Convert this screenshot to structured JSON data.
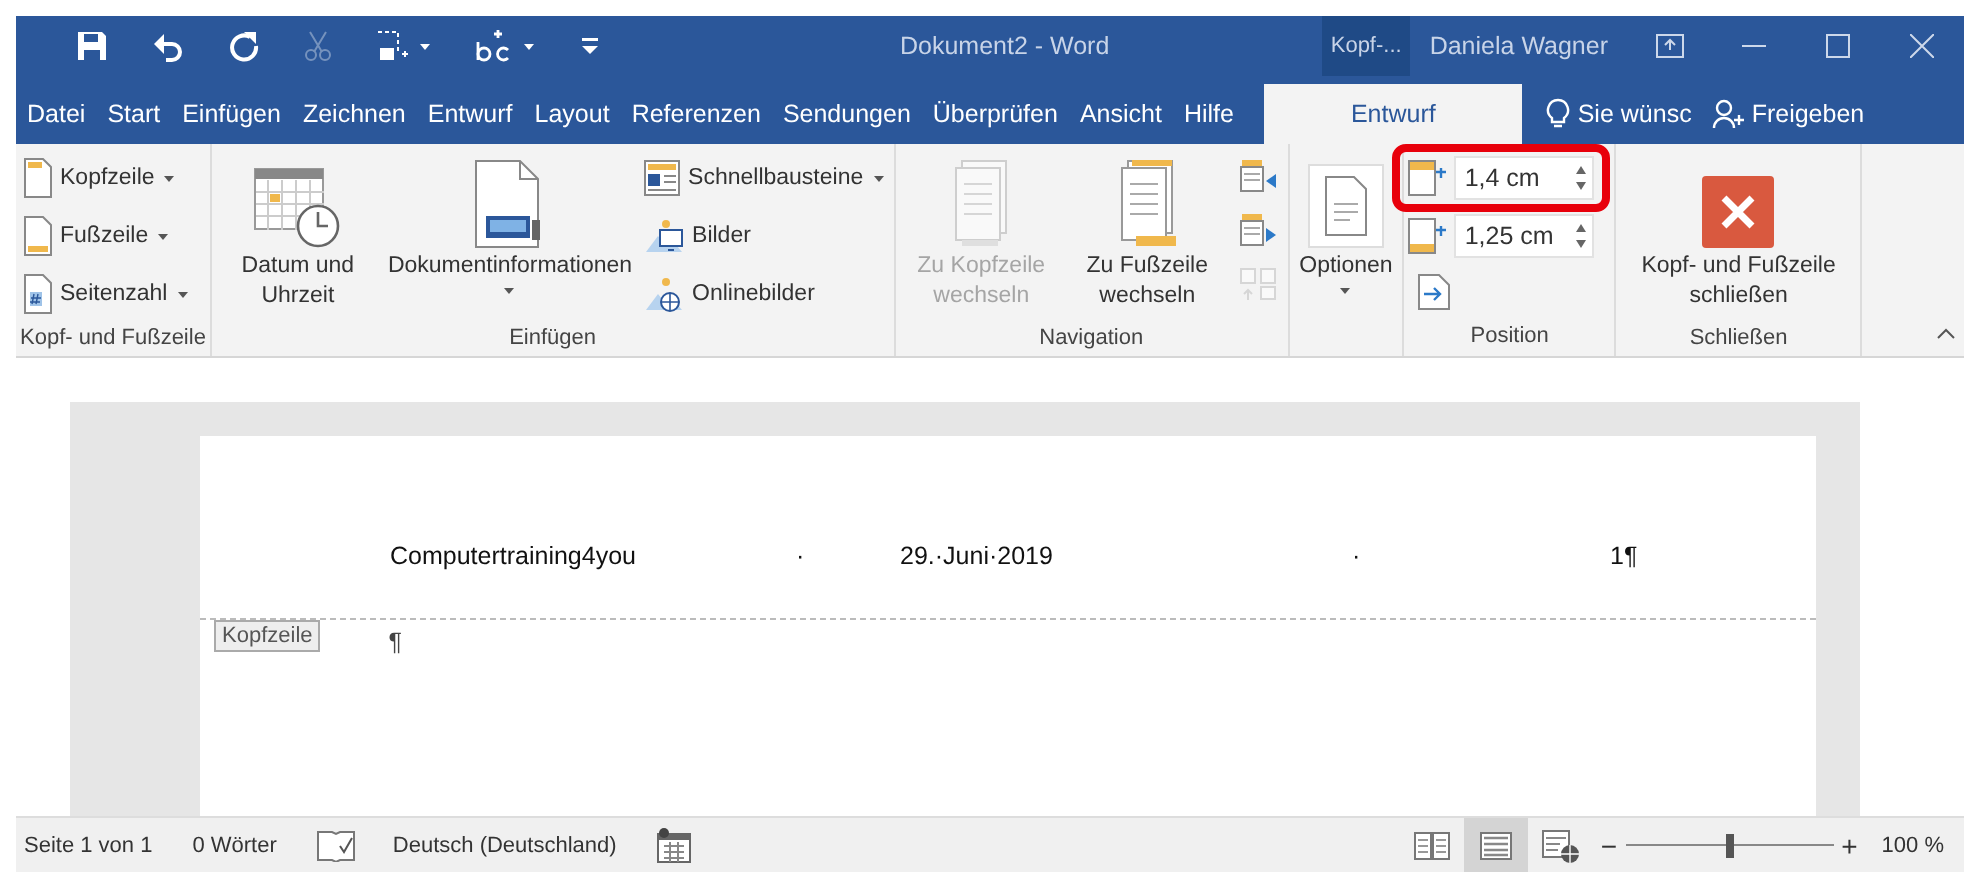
{
  "title_bar": {
    "quick_access": [
      {
        "kind": "save",
        "disabled": false,
        "dropdown": false
      },
      {
        "kind": "undo",
        "disabled": false,
        "dropdown": false
      },
      {
        "kind": "redo",
        "disabled": false,
        "dropdown": false
      },
      {
        "kind": "cut",
        "disabled": true,
        "dropdown": false
      },
      {
        "kind": "screenshot",
        "disabled": false,
        "dropdown": true
      },
      {
        "kind": "spelling",
        "disabled": false,
        "dropdown": true
      },
      {
        "kind": "customize",
        "disabled": false,
        "dropdown": false
      }
    ],
    "document_title": "Dokument2  -  Word",
    "context_tool": "Kopf-...",
    "user": "Daniela Wagner",
    "window_controls": [
      {
        "kind": "ribbon-options"
      },
      {
        "kind": "minimize"
      },
      {
        "kind": "maximize"
      },
      {
        "kind": "close"
      }
    ]
  },
  "tabs": [
    {
      "label": "Datei",
      "selected": false
    },
    {
      "label": "Start",
      "selected": false
    },
    {
      "label": "Einfügen",
      "selected": false
    },
    {
      "label": "Zeichnen",
      "selected": false
    },
    {
      "label": "Entwurf",
      "selected": false
    },
    {
      "label": "Layout",
      "selected": false
    },
    {
      "label": "Referenzen",
      "selected": false
    },
    {
      "label": "Sendungen",
      "selected": false
    },
    {
      "label": "Überprüfen",
      "selected": false
    },
    {
      "label": "Ansicht",
      "selected": false
    },
    {
      "label": "Hilfe",
      "selected": false
    },
    {
      "label": "Entwurf",
      "selected": true
    }
  ],
  "tell_me": "Sie wünsc",
  "share": "Freigeben",
  "ribbon": {
    "groups": [
      {
        "label": "Kopf- und Fußzeile",
        "columns": [
          [
            {
              "kind": "small",
              "label": "Kopfzeile",
              "dropdown": true,
              "disabled": false
            },
            {
              "kind": "small",
              "label": "Fußzeile",
              "dropdown": true,
              "disabled": false
            },
            {
              "kind": "small",
              "label": "Seitenzahl",
              "dropdown": true,
              "disabled": false
            }
          ]
        ]
      },
      {
        "label": "Einfügen",
        "columns": [
          [
            {
              "kind": "large",
              "label": "Datum und Uhrzeit",
              "dropdown": false,
              "disabled": false
            }
          ],
          [
            {
              "kind": "large",
              "label": "Dokumentinformationen",
              "dropdown": true,
              "disabled": false
            }
          ],
          [
            {
              "kind": "small",
              "label": "Schnellbausteine",
              "dropdown": true,
              "disabled": false
            },
            {
              "kind": "small",
              "label": "Bilder",
              "dropdown": false,
              "disabled": false
            },
            {
              "kind": "small",
              "label": "Onlinebilder",
              "dropdown": false,
              "disabled": false
            }
          ]
        ]
      },
      {
        "label": "Navigation",
        "columns": [
          [
            {
              "kind": "large",
              "label": "Zu Kopfzeile wechseln",
              "dropdown": false,
              "disabled": true
            }
          ],
          [
            {
              "kind": "large",
              "label": "Zu Fußzeile wechseln",
              "dropdown": false,
              "disabled": false
            }
          ],
          [
            {
              "kind": "icon",
              "disabled": false
            },
            {
              "kind": "icon",
              "disabled": false
            },
            {
              "kind": "icon",
              "disabled": true
            }
          ]
        ]
      },
      {
        "columns": [
          [
            {
              "kind": "large",
              "label": "Optionen",
              "dropdown": true,
              "disabled": false
            }
          ]
        ]
      },
      {
        "label": "Position",
        "columns": [
          [
            {
              "kind": "spin",
              "value": "1,4 cm",
              "highlighted": true,
              "disabled": false
            },
            {
              "kind": "spin",
              "value": "1,25 cm",
              "highlighted": false,
              "disabled": false
            },
            {
              "kind": "icon",
              "disabled": false
            }
          ]
        ]
      },
      {
        "label": "Schließen",
        "columns": [
          [
            {
              "kind": "close",
              "label": "Kopf- und Fußzeile schließen",
              "dropdown": false,
              "disabled": false
            }
          ]
        ]
      }
    ]
  },
  "document": {
    "header_line": [
      "Computertraining4you",
      "·",
      "29.·Juni·2019",
      "·",
      "1¶"
    ],
    "header_tag": "Kopfzeile",
    "body_line": "¶"
  },
  "status_bar": {
    "page": "Seite 1 von 1",
    "words": "0 Wörter",
    "language": "Deutsch (Deutschland)",
    "views": [
      {
        "kind": "read",
        "selected": false
      },
      {
        "kind": "print",
        "selected": true
      },
      {
        "kind": "web",
        "selected": false
      }
    ],
    "zoom_out": "−",
    "zoom_in": "+",
    "zoom": {
      "level": 0.5
    },
    "zoom_label": "100 %"
  }
}
